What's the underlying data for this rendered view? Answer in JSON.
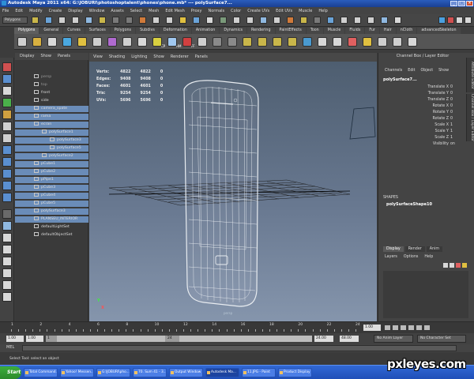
{
  "window": {
    "title": "Autodesk Maya 2011 x64: G:\\JOBURI\\photoshoptalent\\phones\\phone.mb* --- polySurface7..."
  },
  "menubar": [
    "File",
    "Edit",
    "Modify",
    "Create",
    "Display",
    "Window",
    "Assets",
    "Select",
    "Mesh",
    "Edit Mesh",
    "Proxy",
    "Normals",
    "Color",
    "Create UVs",
    "Edit UVs",
    "Muscle",
    "Help"
  ],
  "statusline": {
    "mode": "Polygons"
  },
  "shelf": {
    "tabs": [
      "Polygons",
      "General",
      "Curves",
      "Surfaces",
      "Polygons",
      "Subdivs",
      "Deformation",
      "Animation",
      "Dynamics",
      "Rendering",
      "PaintEffects",
      "Toon",
      "Muscle",
      "Fluids",
      "Fur",
      "Hair",
      "nCloth",
      "advancedSkeleton"
    ],
    "active_tab": 0,
    "labels": {
      "cp": "CP",
      "hm": "HM",
      "ff": "FF"
    }
  },
  "outliner": {
    "menu": [
      "Display",
      "Show",
      "Panels"
    ],
    "rows": [
      {
        "label": "persp",
        "indent": 0,
        "selected": false,
        "dim": true
      },
      {
        "label": "top",
        "indent": 0,
        "selected": false,
        "dim": true
      },
      {
        "label": "front",
        "indent": 0,
        "selected": false,
        "dim": false
      },
      {
        "label": "side",
        "indent": 0,
        "selected": false,
        "dim": false
      },
      {
        "label": "camera_spate",
        "indent": 0,
        "selected": true,
        "dim": false
      },
      {
        "label": "rama",
        "indent": 0,
        "selected": true,
        "dim": false
      },
      {
        "label": "ecran",
        "indent": 0,
        "selected": true,
        "dim": false
      },
      {
        "label": "polySurface1",
        "indent": 1,
        "selected": true,
        "dim": false
      },
      {
        "label": "polySurface3",
        "indent": 2,
        "selected": true,
        "dim": false
      },
      {
        "label": "polySurface5",
        "indent": 2,
        "selected": true,
        "dim": false
      },
      {
        "label": "polySurface2",
        "indent": 1,
        "selected": true,
        "dim": false
      },
      {
        "label": "pCube1",
        "indent": 0,
        "selected": true,
        "dim": false
      },
      {
        "label": "pCube2",
        "indent": 0,
        "selected": true,
        "dim": false
      },
      {
        "label": "pPipe1",
        "indent": 0,
        "selected": true,
        "dim": false
      },
      {
        "label": "pCube3",
        "indent": 0,
        "selected": true,
        "dim": false
      },
      {
        "label": "pCube4",
        "indent": 0,
        "selected": true,
        "dim": false
      },
      {
        "label": "pCube5",
        "indent": 0,
        "selected": true,
        "dim": false
      },
      {
        "label": "polySurface3",
        "indent": 0,
        "selected": true,
        "dim": false
      },
      {
        "label": "PLANSEU_INTERIOR",
        "indent": 0,
        "selected": true,
        "dim": false
      },
      {
        "label": "defaultLightSet",
        "indent": 0,
        "selected": false,
        "dim": false
      },
      {
        "label": "defaultObjectSet",
        "indent": 0,
        "selected": false,
        "dim": false
      }
    ]
  },
  "viewport": {
    "menu": [
      "View",
      "Shading",
      "Lighting",
      "Show",
      "Renderer",
      "Panels"
    ],
    "hud": [
      {
        "label": "Verts:",
        "v1": "4822",
        "v2": "4822",
        "v3": "0"
      },
      {
        "label": "Edges:",
        "v1": "9408",
        "v2": "9408",
        "v3": "0"
      },
      {
        "label": "Faces:",
        "v1": "4601",
        "v2": "4601",
        "v3": "0"
      },
      {
        "label": "Tris:",
        "v1": "9254",
        "v2": "9254",
        "v3": "0"
      },
      {
        "label": "UVs:",
        "v1": "5696",
        "v2": "5696",
        "v3": "0"
      }
    ],
    "camera_label": "persp",
    "axis_y": "Y",
    "axis_x": "X"
  },
  "channelbox": {
    "title": "Channel Box / Layer Editor",
    "menu": [
      "Channels",
      "Edit",
      "Object",
      "Show"
    ],
    "object": "polySurface7...",
    "attrs": [
      {
        "name": "Translate X",
        "value": "0"
      },
      {
        "name": "Translate Y",
        "value": "0"
      },
      {
        "name": "Translate Z",
        "value": "0"
      },
      {
        "name": "Rotate X",
        "value": "0"
      },
      {
        "name": "Rotate Y",
        "value": "0"
      },
      {
        "name": "Rotate Z",
        "value": "0"
      },
      {
        "name": "Scale X",
        "value": "1"
      },
      {
        "name": "Scale Y",
        "value": "1"
      },
      {
        "name": "Scale Z",
        "value": "1"
      },
      {
        "name": "Visibility",
        "value": "on"
      }
    ],
    "shapes_label": "SHAPES",
    "shape_name": "polySurfaceShape10",
    "layer_tabs": [
      "Display",
      "Render",
      "Anim"
    ],
    "layer_menu": [
      "Layers",
      "Options",
      "Help"
    ],
    "side_tabs": [
      "Attribute Editor",
      "Channel Box / Layer Editor"
    ]
  },
  "timeslider": {
    "ticks": [
      "1",
      "2",
      "4",
      "6",
      "8",
      "10",
      "12",
      "14",
      "16",
      "18",
      "20",
      "22",
      "24"
    ],
    "current_frame": "1.00"
  },
  "rangeslider": {
    "start": "1.00",
    "inner_start": "1.00",
    "left_handle": "1",
    "right_handle": "24",
    "end_inner": "24.00",
    "end": "48.00",
    "anim_layer": "No Anim Layer",
    "character": "No Character Set"
  },
  "cmdline": {
    "label": "MEL"
  },
  "helpline": {
    "text": "Select Tool: select an object"
  },
  "taskbar": {
    "start": "Start",
    "tasks": [
      {
        "label": "Total Command...",
        "active": false
      },
      {
        "label": "Yahoo! Messen...",
        "active": false
      },
      {
        "label": "G:\\JOBURI\\pho...",
        "active": false
      },
      {
        "label": "70. Sum 41 - 3...",
        "active": false
      },
      {
        "label": "Output Window",
        "active": false
      },
      {
        "label": "Autodesk Ma...",
        "active": true
      },
      {
        "label": "11.JPG - Paint",
        "active": false
      },
      {
        "label": "Product Display ...",
        "active": false
      }
    ]
  },
  "watermark": "pxleyes.com",
  "colors": {
    "selection": "#6a8cb8",
    "viewport_top": "#4e5e70",
    "viewport_bottom": "#8595ac",
    "titlebar": "#2a5dbd",
    "taskbar": "#3168d5"
  }
}
